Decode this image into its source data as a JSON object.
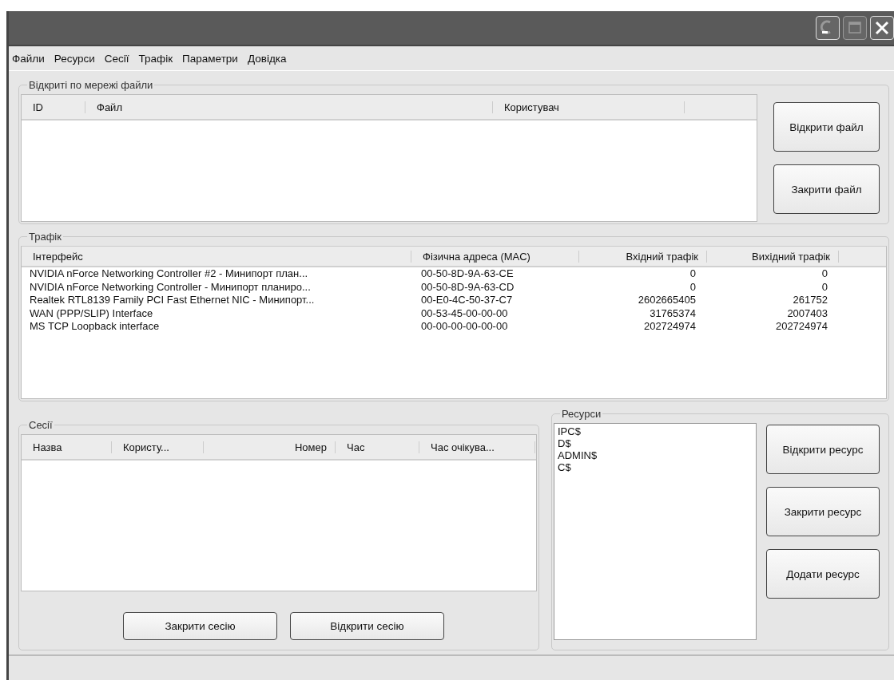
{
  "window": {
    "title_buttons": [
      {
        "kind": "minimize",
        "disabled": false
      },
      {
        "kind": "maximize",
        "disabled": true
      },
      {
        "kind": "close",
        "disabled": false
      }
    ]
  },
  "menu": [
    "Файли",
    "Ресурси",
    "Сесії",
    "Трафік",
    "Параметри",
    "Довідка"
  ],
  "open_files": {
    "title": "Відкриті по мережі файли",
    "columns": [
      "ID",
      "Файл",
      "Користувач"
    ],
    "buttons": [
      "Відкрити файл",
      "Закрити файл"
    ]
  },
  "traffic": {
    "title": "Трафік",
    "columns": [
      "Інтерфейс",
      "Фізична адреса (MAC)",
      "Вхідний трафік",
      "Вихідний трафік"
    ],
    "rows": [
      [
        "NVIDIA nForce Networking Controller #2 - Минипорт план...",
        "00-50-8D-9A-63-CE",
        "0",
        "0"
      ],
      [
        "NVIDIA nForce Networking Controller - Минипорт планиро...",
        "00-50-8D-9A-63-CD",
        "0",
        "0"
      ],
      [
        "Realtek RTL8139 Family PCI Fast Ethernet NIC - Минипорт...",
        "00-E0-4C-50-37-C7",
        "2602665405",
        "261752"
      ],
      [
        "WAN (PPP/SLIP) Interface",
        "00-53-45-00-00-00",
        "31765374",
        "2007403"
      ],
      [
        "MS TCP Loopback interface",
        "00-00-00-00-00-00",
        "202724974",
        "202724974"
      ]
    ]
  },
  "sessions": {
    "title": "Сесії",
    "columns": [
      "Назва",
      "Користу...",
      "Номер",
      "Час",
      "Час очікува..."
    ],
    "buttons": [
      "Закрити сесію",
      "Відкрити сесію"
    ]
  },
  "resources": {
    "title": "Ресурси",
    "items": [
      "IPC$",
      "D$",
      "ADMIN$",
      "C$"
    ],
    "buttons": [
      "Відкрити ресурс",
      "Закрити ресурс",
      "Додати ресурс"
    ]
  }
}
